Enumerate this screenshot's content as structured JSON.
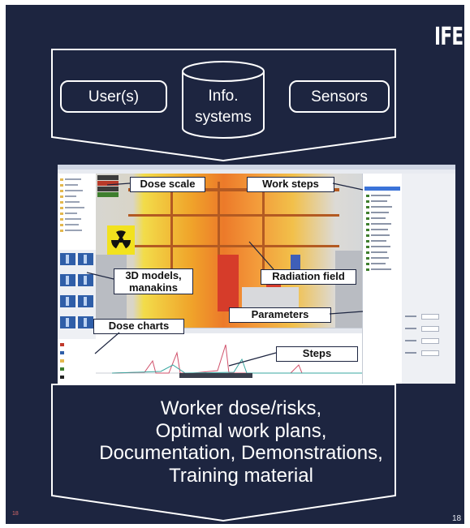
{
  "logo": "IFE",
  "page_number": "18",
  "page_number_margin": "18",
  "inputs": {
    "users": "User(s)",
    "info_systems_line1": "Info.",
    "info_systems_line2": "systems",
    "sensors": "Sensors"
  },
  "callouts": {
    "dose_scale": "Dose scale",
    "work_steps": "Work steps",
    "models_line1": "3D models,",
    "models_line2": "manakins",
    "radiation_field": "Radiation field",
    "parameters": "Parameters",
    "dose_charts": "Dose charts",
    "steps": "Steps"
  },
  "outputs": [
    "Worker dose/risks,",
    "Optimal work plans,",
    "Documentation, Demonstrations,",
    "Training material"
  ],
  "colors": {
    "background": "#1d2540",
    "radiation": "#f2e21e"
  },
  "icons": [
    "radiation-icon"
  ]
}
